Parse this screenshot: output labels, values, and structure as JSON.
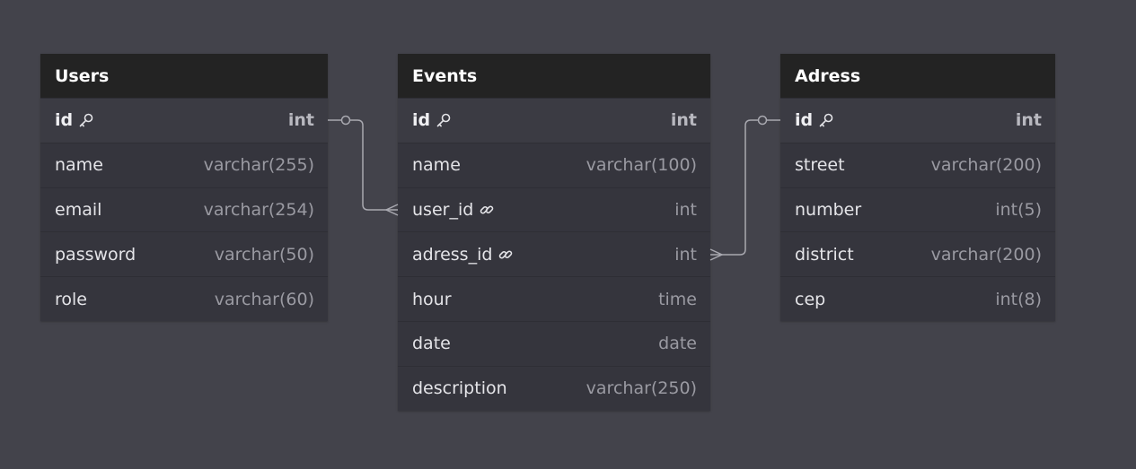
{
  "tables": {
    "users": {
      "title": "Users",
      "fields": [
        {
          "name": "id",
          "type": "int",
          "icon": "key-icon"
        },
        {
          "name": "name",
          "type": "varchar(255)"
        },
        {
          "name": "email",
          "type": "varchar(254)"
        },
        {
          "name": "password",
          "type": "varchar(50)"
        },
        {
          "name": "role",
          "type": "varchar(60)"
        }
      ]
    },
    "events": {
      "title": "Events",
      "fields": [
        {
          "name": "id",
          "type": "int",
          "icon": "key-icon"
        },
        {
          "name": "name",
          "type": "varchar(100)"
        },
        {
          "name": "user_id",
          "type": "int",
          "icon": "link-icon"
        },
        {
          "name": "adress_id",
          "type": "int",
          "icon": "link-icon"
        },
        {
          "name": "hour",
          "type": "time"
        },
        {
          "name": "date",
          "type": "date"
        },
        {
          "name": "description",
          "type": "varchar(250)"
        }
      ]
    },
    "adress": {
      "title": "Adress",
      "fields": [
        {
          "name": "id",
          "type": "int",
          "icon": "key-icon"
        },
        {
          "name": "street",
          "type": "varchar(200)"
        },
        {
          "name": "number",
          "type": "int(5)"
        },
        {
          "name": "district",
          "type": "varchar(200)"
        },
        {
          "name": "cep",
          "type": "int(8)"
        }
      ]
    }
  },
  "relationships": [
    {
      "from": "Users.id",
      "to": "Events.user_id",
      "cardinality": "one-to-many"
    },
    {
      "from": "Adress.id",
      "to": "Events.adress_id",
      "cardinality": "one-to-many"
    }
  ],
  "colors": {
    "canvas": "#43434b",
    "header": "#232323",
    "body": "#35353d",
    "connector": "#a9a9b0"
  }
}
